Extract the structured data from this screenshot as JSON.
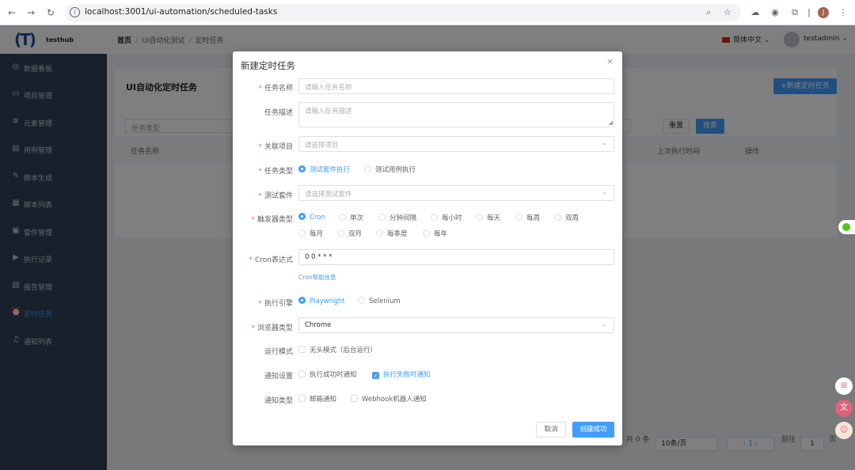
{
  "browser": {
    "url": "localhost:3001/ui-automation/scheduled-tasks",
    "profile_initial": "J"
  },
  "header": {
    "logo_text": "testhub",
    "breadcrumb": [
      "首页",
      "UI自动化测试",
      "定时任务"
    ],
    "language": "简体中文",
    "user": "testadmin"
  },
  "sidebar": {
    "items": [
      {
        "label": "数据看板",
        "icon": "dashboard-icon",
        "active": false
      },
      {
        "label": "项目管理",
        "icon": "folder-icon",
        "active": false
      },
      {
        "label": "元素管理",
        "icon": "element-icon",
        "active": false
      },
      {
        "label": "用例管理",
        "icon": "document-icon",
        "active": false
      },
      {
        "label": "脚本生成",
        "icon": "edit-icon",
        "active": false
      },
      {
        "label": "脚本列表",
        "icon": "list-icon",
        "active": false
      },
      {
        "label": "套件管理",
        "icon": "suite-icon",
        "active": false
      },
      {
        "label": "执行记录",
        "icon": "play-icon",
        "active": false
      },
      {
        "label": "报告管理",
        "icon": "report-icon",
        "active": false
      },
      {
        "label": "定时任务",
        "icon": "alarm-icon",
        "active": true
      },
      {
        "label": "通知列表",
        "icon": "bell-icon",
        "active": false
      }
    ]
  },
  "page": {
    "title": "UI自动化定时任务",
    "add_button": "+新建定时任务",
    "filter_placeholder": "任务类型",
    "reset": "重置",
    "search": "搜索",
    "columns": [
      "任务名称",
      "上次执行时间",
      "操作"
    ],
    "pagination": {
      "total": "共 0 条",
      "page_size": "10条/页",
      "current": "1",
      "goto_label": "前往",
      "goto_value": "1",
      "page_unit": "页"
    }
  },
  "modal": {
    "title": "新建定时任务",
    "fields": {
      "name_label": "任务名称",
      "name_placeholder": "请输入任务名称",
      "desc_label": "任务描述",
      "desc_placeholder": "请输入任务描述",
      "project_label": "关联项目",
      "project_placeholder": "请选择项目",
      "type_label": "任务类型",
      "type_options": [
        "测试套件执行",
        "测试用例执行"
      ],
      "suite_label": "测试套件",
      "suite_placeholder": "请选择测试套件",
      "trigger_label": "触发器类型",
      "trigger_options": [
        "Cron",
        "单次",
        "分钟间隔",
        "每小时",
        "每天",
        "每周",
        "双周",
        "每月",
        "双月",
        "每季度",
        "每年"
      ],
      "cron_label": "Cron表达式",
      "cron_value": "0 0 * * *",
      "cron_help": "Cron帮助信息",
      "engine_label": "执行引擎",
      "engine_options": [
        "Playwright",
        "Selenium"
      ],
      "browser_label": "浏览器类型",
      "browser_value": "Chrome",
      "mode_label": "运行模式",
      "mode_option": "无头模式（后台运行）",
      "notify_label": "通知设置",
      "notify_options": [
        "执行成功时通知",
        "执行失败时通知"
      ],
      "notify_type_label": "通知类型",
      "notify_type_options": [
        "邮箱通知",
        "Webhook机器人通知"
      ]
    },
    "cancel": "取消",
    "submit": "创建成功"
  }
}
